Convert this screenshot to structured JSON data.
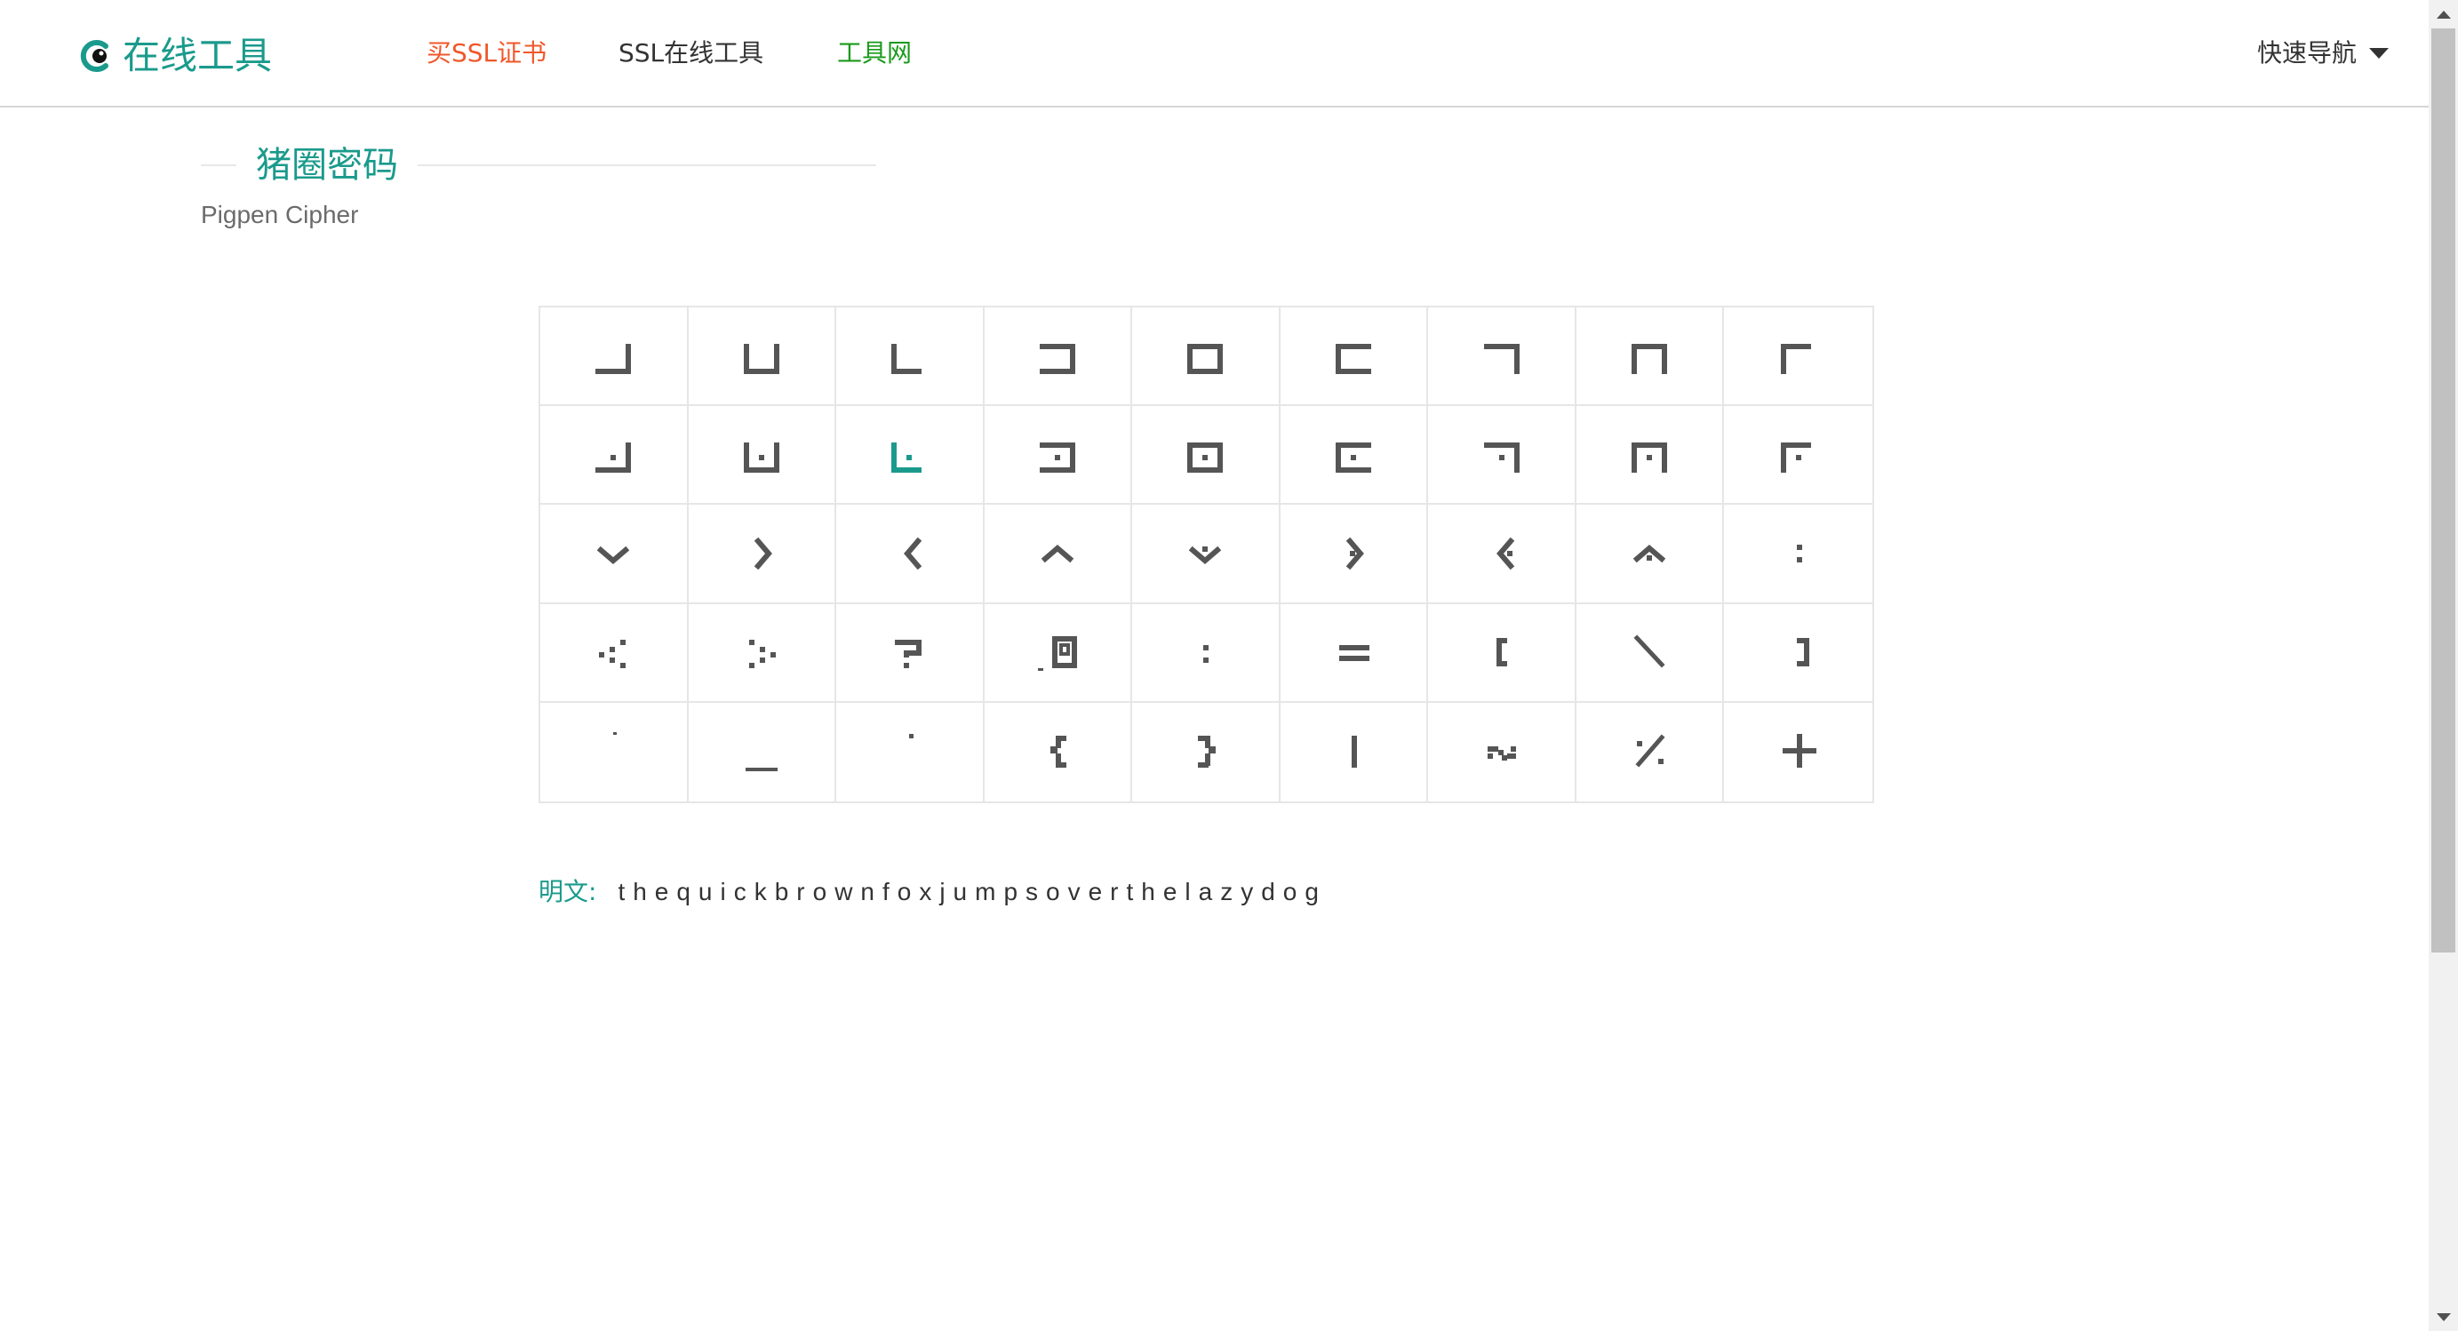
{
  "header": {
    "logo_text": "在线工具",
    "nav": [
      {
        "label": "买SSL证书",
        "color": "#f0572a"
      },
      {
        "label": "SSL在线工具",
        "color": "#333333"
      },
      {
        "label": "工具网",
        "color": "#1a9a1a"
      }
    ],
    "quick_nav_label": "快速导航"
  },
  "page": {
    "title": "猪圈密码",
    "subtitle": "Pigpen Cipher"
  },
  "cipher": {
    "accent_color": "#1a9a8c",
    "glyph_color": "#555555",
    "highlighted_glyph": "l",
    "glyphs": [
      "a",
      "b",
      "c",
      "d",
      "e",
      "f",
      "g",
      "h",
      "i",
      "j",
      "k",
      "l",
      "m",
      "n",
      "o",
      "p",
      "q",
      "r",
      "s",
      "t",
      "u",
      "v",
      "w",
      "x",
      "y",
      "z",
      "colon",
      "less-than-dots",
      "greater-than-dots",
      "question-box",
      "at-box",
      "colon-small",
      "equals",
      "bracket-left",
      "backslash",
      "bracket-right",
      "apostrophe",
      "underscore",
      "period",
      "brace-left",
      "brace-right",
      "pipe",
      "tilde",
      "percent",
      "plus"
    ]
  },
  "plaintext": {
    "label": "明文:",
    "value": "thequickbrownfoxjumpsoverthelazydog"
  }
}
